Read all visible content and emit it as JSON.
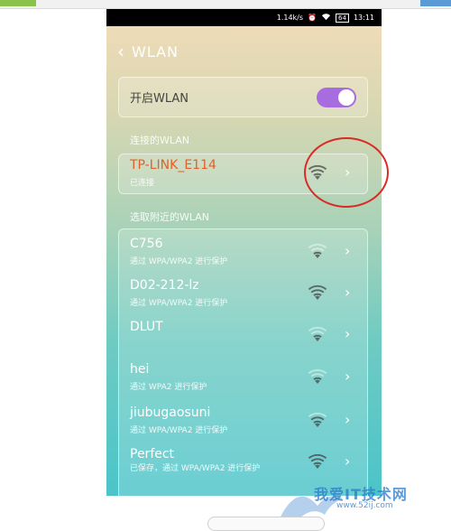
{
  "status_bar": {
    "network_speed": "1.14k/s",
    "alarm_icon": "alarm-icon",
    "wifi_icon": "wifi-icon",
    "battery": "64",
    "time": "13:11"
  },
  "header": {
    "title": "WLAN",
    "back_icon": "chevron-left-icon"
  },
  "toggle": {
    "label": "开启WLAN",
    "on": true,
    "accent": "#a76ce0"
  },
  "sections": {
    "connected": "连接的WLAN",
    "available": "选取附近的WLAN"
  },
  "connected_network": {
    "name": "TP-LINK_E114",
    "status": "已连接",
    "signal": 3,
    "color": "#e0612b"
  },
  "networks": [
    {
      "name": "C756",
      "sub": "通过 WPA/WPA2 进行保护",
      "signal": 1
    },
    {
      "name": "D02-212-lz",
      "sub": "通过 WPA/WPA2 进行保护",
      "signal": 3
    },
    {
      "name": "DLUT",
      "sub": "",
      "signal": 1
    },
    {
      "name": "hei",
      "sub": "通过 WPA2 进行保护",
      "signal": 1
    },
    {
      "name": "jiubugaosuni",
      "sub": "通过 WPA/WPA2 进行保护",
      "signal": 2
    },
    {
      "name": "Perfect",
      "sub": "已保存，通过 WPA/WPA2 进行保护",
      "signal": 3
    }
  ],
  "watermark": {
    "text": "我爱IT技术网",
    "url": "www.52ij.com"
  }
}
